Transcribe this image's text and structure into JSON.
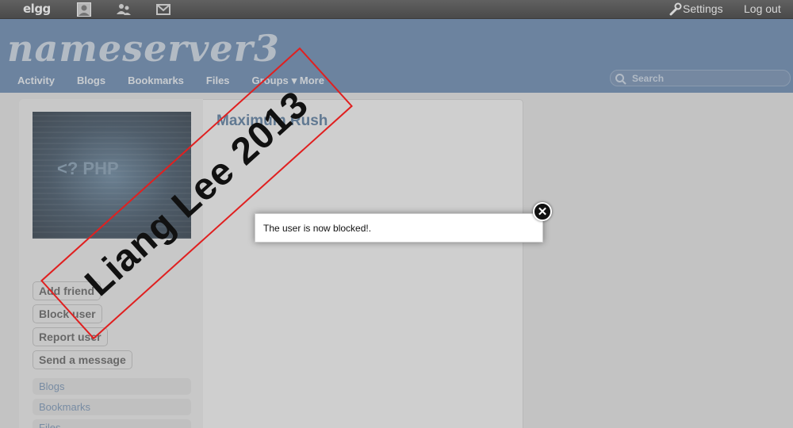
{
  "topbar": {
    "logo": "elgg",
    "settings_label": "Settings",
    "logout_label": "Log out"
  },
  "header": {
    "site_name": "nameserver3",
    "nav": [
      {
        "label": "Activity"
      },
      {
        "label": "Blogs"
      },
      {
        "label": "Bookmarks"
      },
      {
        "label": "Files"
      },
      {
        "label": "Groups"
      },
      {
        "label": "More"
      }
    ],
    "search_placeholder": "Search"
  },
  "profile": {
    "name": "Maximum Rush",
    "avatar_text": "<? PHP",
    "actions": [
      {
        "label": "Add friend"
      },
      {
        "label": "Block user"
      },
      {
        "label": "Report user"
      },
      {
        "label": "Send a message"
      }
    ],
    "owner_links": [
      {
        "label": "Blogs"
      },
      {
        "label": "Bookmarks"
      },
      {
        "label": "Files"
      }
    ]
  },
  "watermark": "Liang Lee 2013",
  "popup": {
    "message": "The user is now blocked!.",
    "close_icon": "close-circle-icon"
  },
  "colors": {
    "header": "#5b7ea9",
    "watermark_border": "#e02020",
    "link": "#4a6f96"
  }
}
